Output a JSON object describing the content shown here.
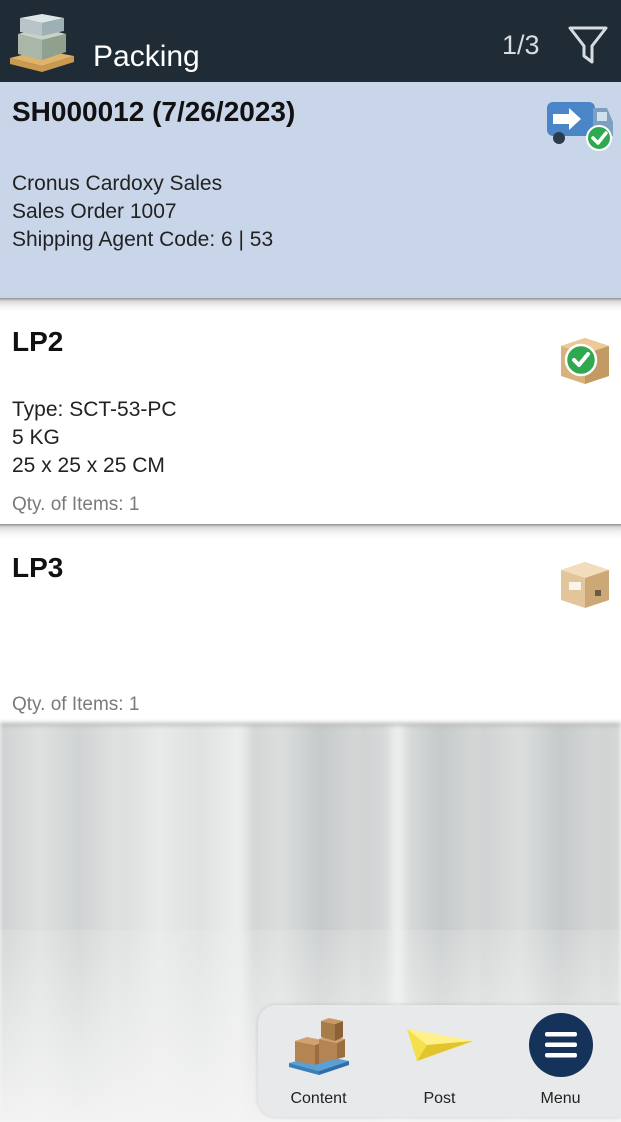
{
  "header": {
    "title": "Packing",
    "counter": "1/3",
    "app_icon": "pallet-boxes-icon",
    "filter_icon": "filter-funnel-icon"
  },
  "shipment": {
    "title": "SH000012 (7/26/2023)",
    "customer": "Cronus Cardoxy Sales",
    "order": "Sales Order 1007",
    "shipping_agent": "Shipping Agent Code: 6 | 53",
    "status_icon": "truck-checked-icon"
  },
  "packages": [
    {
      "title": "LP2",
      "type": "Type: SCT-53-PC",
      "weight": "5 KG",
      "dimensions": "25 x 25 x 25 CM",
      "qty": "Qty. of Items: 1",
      "status_icon": "box-checked-icon"
    },
    {
      "title": "LP3",
      "qty": "Qty. of Items: 1",
      "status_icon": "box-icon"
    }
  ],
  "toolbar": {
    "content_label": "Content",
    "post_label": "Post",
    "menu_label": "Menu"
  },
  "colors": {
    "header_bg": "#1f2b35",
    "selected_card_bg": "#c9d6ea",
    "menu_circle": "#14325a",
    "check_green": "#2fa84f"
  }
}
